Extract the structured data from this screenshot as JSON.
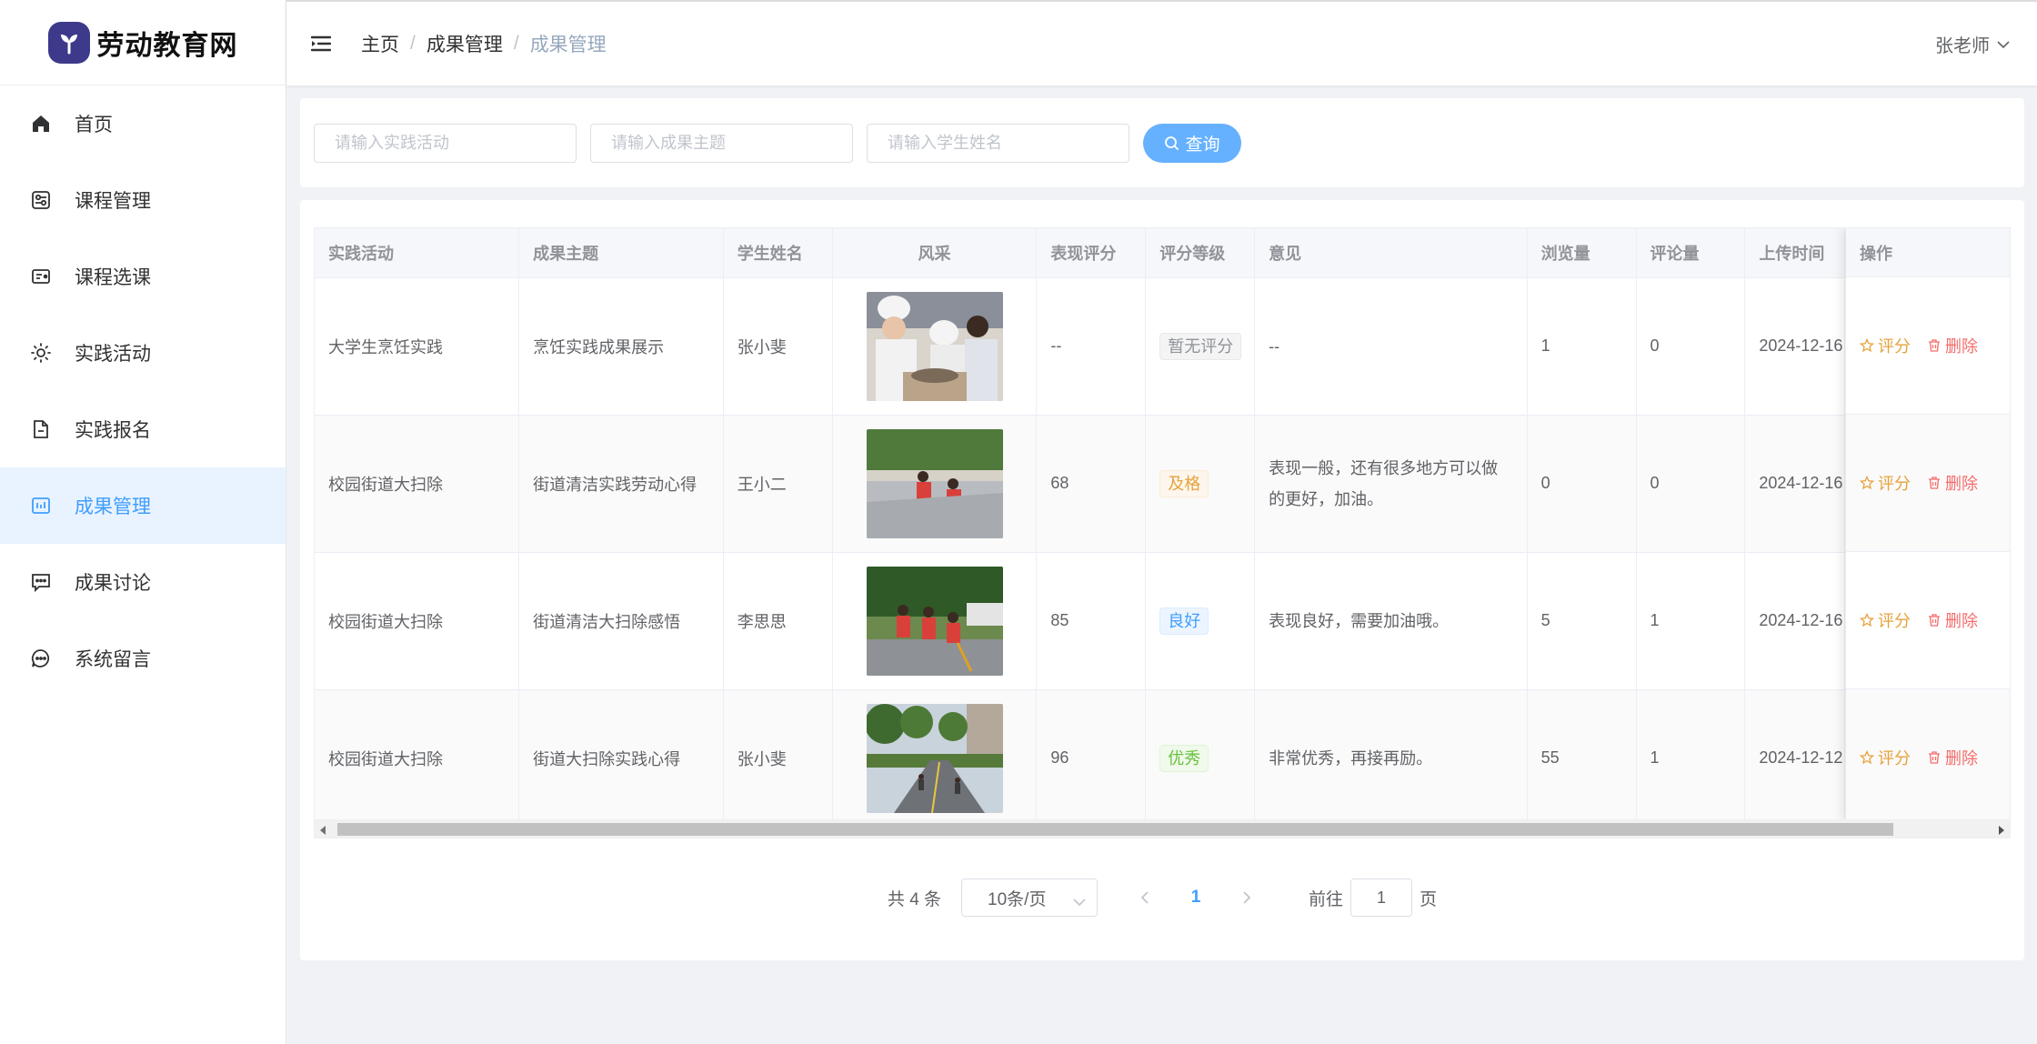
{
  "app": {
    "logo_text": "劳动教育网"
  },
  "sidebar": {
    "items": [
      {
        "label": "首页",
        "icon": "home-icon",
        "active": false
      },
      {
        "label": "课程管理",
        "icon": "course-icon",
        "active": false
      },
      {
        "label": "课程选课",
        "icon": "select-course-icon",
        "active": false
      },
      {
        "label": "实践活动",
        "icon": "sun-icon",
        "active": false
      },
      {
        "label": "实践报名",
        "icon": "document-icon",
        "active": false
      },
      {
        "label": "成果管理",
        "icon": "results-icon",
        "active": true
      },
      {
        "label": "成果讨论",
        "icon": "chat-icon",
        "active": false
      },
      {
        "label": "系统留言",
        "icon": "message-icon",
        "active": false
      }
    ]
  },
  "header": {
    "breadcrumb": [
      "主页",
      "成果管理",
      "成果管理"
    ],
    "user": "张老师"
  },
  "search": {
    "activity_placeholder": "请输入实践活动",
    "topic_placeholder": "请输入成果主题",
    "student_placeholder": "请输入学生姓名",
    "query_label": "查询"
  },
  "table": {
    "columns": [
      "实践活动",
      "成果主题",
      "学生姓名",
      "风采",
      "表现评分",
      "评分等级",
      "意见",
      "浏览量",
      "评论量",
      "上传时间",
      "操作"
    ],
    "rows": [
      {
        "activity": "大学生烹饪实践",
        "topic": "烹饪实践成果展示",
        "student": "张小斐",
        "score": "--",
        "grade": "暂无评分",
        "grade_type": "info",
        "opinion": "--",
        "views": "1",
        "comments": "0",
        "time": "2024-12-16"
      },
      {
        "activity": "校园街道大扫除",
        "topic": "街道清洁实践劳动心得",
        "student": "王小二",
        "score": "68",
        "grade": "及格",
        "grade_type": "warning",
        "opinion": "表现一般，还有很多地方可以做的更好，加油。",
        "views": "0",
        "comments": "0",
        "time": "2024-12-16"
      },
      {
        "activity": "校园街道大扫除",
        "topic": "街道清洁大扫除感悟",
        "student": "李思思",
        "score": "85",
        "grade": "良好",
        "grade_type": "primary",
        "opinion": "表现良好，需要加油哦。",
        "views": "5",
        "comments": "1",
        "time": "2024-12-16"
      },
      {
        "activity": "校园街道大扫除",
        "topic": "街道大扫除实践心得",
        "student": "张小斐",
        "score": "96",
        "grade": "优秀",
        "grade_type": "success",
        "opinion": "非常优秀，再接再励。",
        "views": "55",
        "comments": "1",
        "time": "2024-12-12"
      }
    ],
    "actions": {
      "rate": "评分",
      "delete": "删除"
    }
  },
  "pagination": {
    "total": "共 4 条",
    "page_size": "10条/页",
    "current_page": "1",
    "goto_prefix": "前往",
    "goto_value": "1",
    "goto_suffix": "页"
  },
  "colors": {
    "primary": "#409eff",
    "warning": "#e6a23c",
    "danger": "#f56c6c",
    "success": "#67c23a"
  }
}
